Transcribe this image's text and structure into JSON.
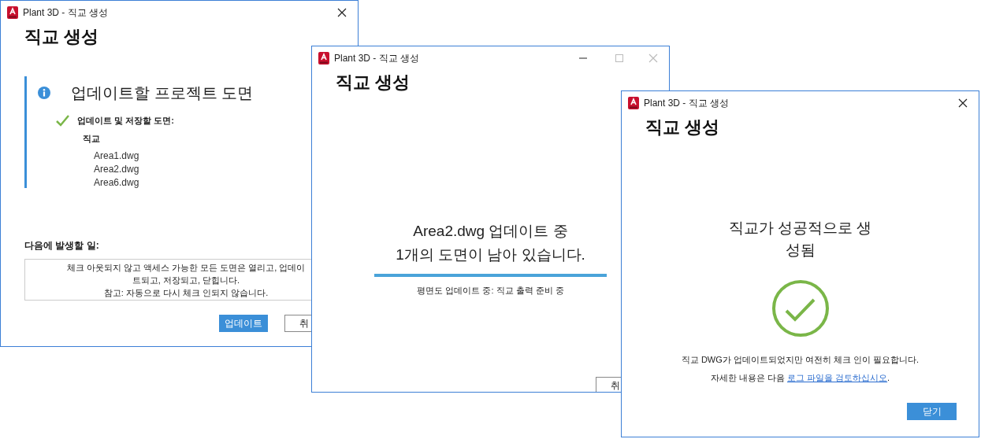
{
  "windows": [
    {
      "kind": "review",
      "title": "Plant 3D - 직교 생성",
      "heading": "직교 생성",
      "title_buttons": [
        {
          "kind": "close",
          "disabled": false
        }
      ],
      "section": {
        "title": "업데이트할 프로젝트 도면",
        "check_label": "업데이트 및 저장할 도면:",
        "group": "직교",
        "files": [
          "Area1.dwg",
          "Area2.dwg",
          "Area6.dwg"
        ]
      },
      "next_label": "다음에 발생할 일:",
      "description_lines": [
        "체크 아웃되지 않고 액세스 가능한 모든 도면은 열리고, 업데이",
        "트되고, 저장되고, 닫힙니다.",
        "참고: 자동으로 다시 체크 인되지 않습니다."
      ],
      "buttons": [
        {
          "label": "업데이트",
          "primary": true
        },
        {
          "label": "취",
          "primary": false
        }
      ]
    },
    {
      "kind": "progress",
      "title": "Plant 3D - 직교 생성",
      "heading": "직교 생성",
      "title_buttons": [
        {
          "kind": "minimize",
          "disabled": false
        },
        {
          "kind": "maximize",
          "disabled": true
        },
        {
          "kind": "close",
          "disabled": true
        }
      ],
      "message_lines": [
        "Area2.dwg 업데이트 중",
        "1개의 도면이 남아 있습니다."
      ],
      "progress": {
        "level": 1
      },
      "status": "평면도 업데이트 중: 직교 출력 준비 중",
      "buttons": [
        {
          "label": "취",
          "primary": false
        }
      ]
    },
    {
      "kind": "success",
      "title": "Plant 3D - 직교 생성",
      "heading": "직교 생성",
      "title_buttons": [
        {
          "kind": "close",
          "disabled": false
        }
      ],
      "message_lines": [
        "직교가 성공적으로 생",
        "성됨"
      ],
      "note": "직교 DWG가 업데이트되었지만 여전히 체크 인이 필요합니다.",
      "detail_prefix": "자세한 내용은 다음 ",
      "link": "로그 파일을 검토하십시오",
      "detail_suffix": ".",
      "buttons": [
        {
          "label": "닫기",
          "primary": true
        }
      ]
    }
  ]
}
